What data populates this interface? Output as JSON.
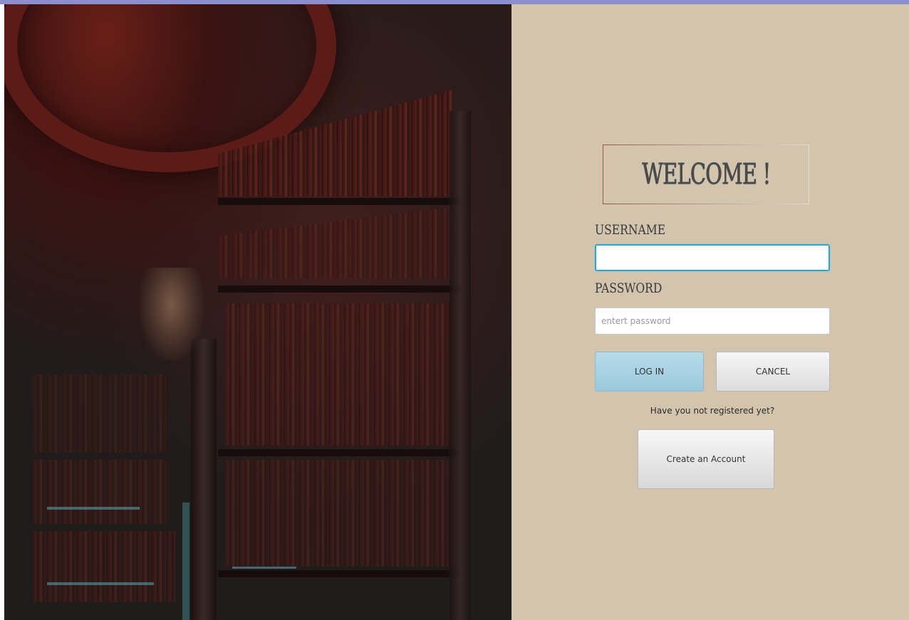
{
  "login": {
    "welcome_title": "WELCOME !",
    "username_label": "USERNAME",
    "username_value": "",
    "username_placeholder": "",
    "password_label": "PASSWORD",
    "password_placeholder": "entert password",
    "login_button": "LOG IN",
    "cancel_button": "CANCEL",
    "register_prompt": "Have you not registered yet?",
    "create_account_button": "Create an Account"
  },
  "colors": {
    "panel_background": "#d3c4ae",
    "login_button": "#a8d2e3",
    "focus_border": "#2ea6cf",
    "window_border": "#8b8fd0"
  },
  "icons": {
    "background_image": "library-bookshelves-photo"
  }
}
